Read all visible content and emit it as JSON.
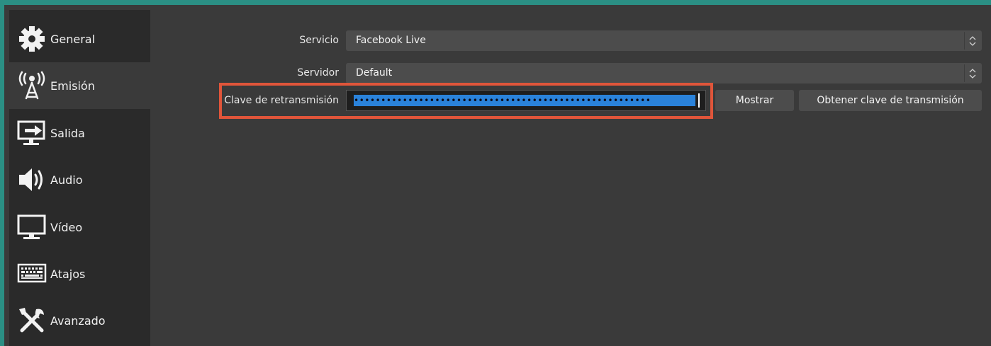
{
  "sidebar": {
    "items": [
      {
        "label": "General",
        "icon": "gear-icon"
      },
      {
        "label": "Emisión",
        "icon": "broadcast-antenna-icon"
      },
      {
        "label": "Salida",
        "icon": "output-monitor-icon"
      },
      {
        "label": "Audio",
        "icon": "speaker-icon"
      },
      {
        "label": "Vídeo",
        "icon": "monitor-icon"
      },
      {
        "label": "Atajos",
        "icon": "keyboard-icon"
      },
      {
        "label": "Avanzado",
        "icon": "tools-icon"
      }
    ],
    "selected": "Emisión"
  },
  "stream": {
    "service_label": "Servicio",
    "service_value": "Facebook Live",
    "server_label": "Servidor",
    "server_value": "Default",
    "key_label": "Clave de retransmisión",
    "key_value": "•••••••••••••••••••••••••••••••••••••••••••••••••••••••",
    "show_button": "Mostrar",
    "get_key_button": "Obtener clave de transmisión"
  },
  "colors": {
    "accent_selection": "#2a82da",
    "highlight_border": "#e0553a",
    "background_teal": "#2b8f84"
  }
}
